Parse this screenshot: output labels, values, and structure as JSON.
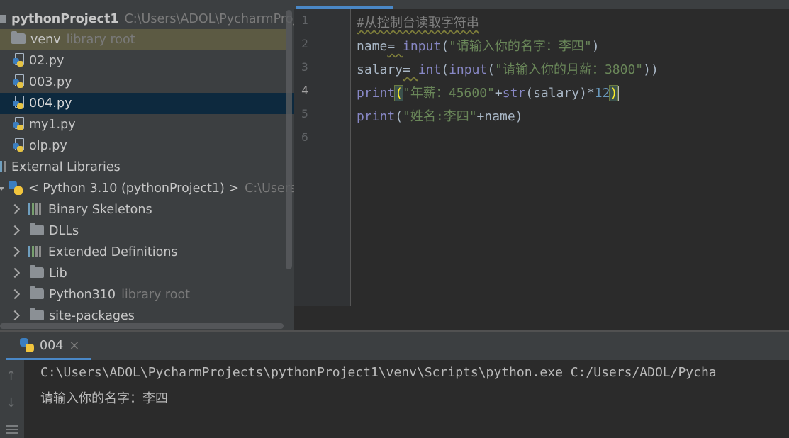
{
  "project_tree": {
    "project_name": "pythonProject1",
    "project_path": "C:\\Users\\ADOL\\PycharmProje",
    "venv_label": "venv",
    "venv_hint": "library root",
    "files": [
      "02.py",
      "003.py",
      "004.py",
      "my1.py",
      "olp.py"
    ],
    "selected_file": "004.py",
    "external_libraries": "External Libraries",
    "python_sdk": "< Python 3.10 (pythonProject1) >",
    "python_sdk_path": "C:\\Users\\",
    "sdk_children": [
      {
        "label": "Binary Skeletons",
        "icon": "library-icon",
        "hint": ""
      },
      {
        "label": "DLLs",
        "icon": "folder-icon",
        "hint": ""
      },
      {
        "label": "Extended Definitions",
        "icon": "library-icon",
        "hint": ""
      },
      {
        "label": "Lib",
        "icon": "folder-icon",
        "hint": ""
      },
      {
        "label": "Python310",
        "icon": "folder-icon",
        "hint": "library root"
      },
      {
        "label": "site-packages",
        "icon": "folder-icon",
        "hint": ""
      }
    ]
  },
  "editor": {
    "line_numbers": [
      "1",
      "2",
      "3",
      "4",
      "5",
      "6"
    ],
    "current_line": "4",
    "lines": {
      "l1_comment": "#从控制台读取字符串",
      "l2_name": "name",
      "l2_eq": "= ",
      "l2_fn": "input",
      "l2_open": "(",
      "l2_str": "\"请输入你的名字：李四\"",
      "l2_close": ")",
      "l3_name": "salary",
      "l3_eq": "= ",
      "l3_fn1": "int",
      "l3_open1": "(",
      "l3_fn2": "input",
      "l3_open2": "(",
      "l3_str": "\"请输入你的月薪：3800\"",
      "l3_close": "))",
      "l4_fn": "print",
      "l4_open": "(",
      "l4_str": "\"年薪：45600\"",
      "l4_plus": "+",
      "l4_fn2": "str",
      "l4_arg": "(salary)*",
      "l4_num": "12",
      "l4_close": ")",
      "l5_fn": "print",
      "l5_open": "(",
      "l5_str": "\"姓名:李四\"",
      "l5_rest": "+name)"
    }
  },
  "run_panel": {
    "tab_label": "004",
    "close_glyph": "×",
    "output_lines": [
      "C:\\Users\\ADOL\\PycharmProjects\\pythonProject1\\venv\\Scripts\\python.exe C:/Users/ADOL/Pycha",
      "请输入你的名字：李四"
    ]
  },
  "colors": {
    "selection": "#0d293e",
    "accent": "#4a88c7",
    "string": "#6a8759",
    "builtin": "#8888c6",
    "number": "#6897bb"
  }
}
